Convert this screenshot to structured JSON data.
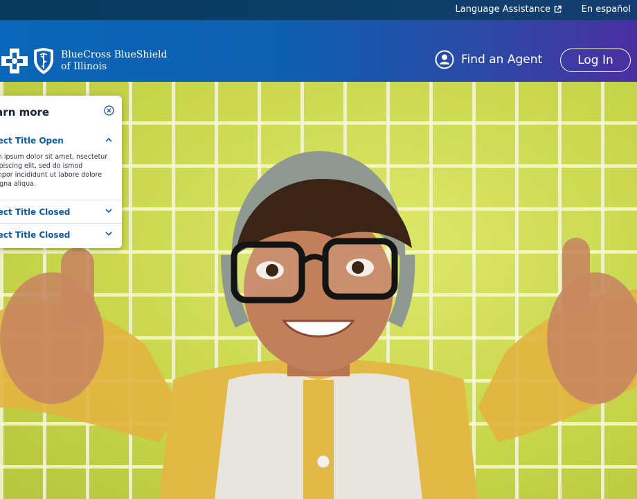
{
  "utility_bar": {
    "language_assistance": "Language Assistance",
    "espanol": "En español"
  },
  "header": {
    "brand_line1": "BlueCross BlueShield",
    "brand_line2": "of Illinois",
    "find_agent": "Find an Agent",
    "login": "Log In"
  },
  "panel": {
    "title": "earn more",
    "accordion": [
      {
        "title": "bject Title Open",
        "state": "open",
        "body": "rem ipsum dolor sit amet, nsectetur adipiscing elit, sed do ismod tempor incididunt ut labore dolore magna aliqua."
      },
      {
        "title": "bject Title Closed",
        "state": "closed"
      },
      {
        "title": "bject Title Closed",
        "state": "closed"
      }
    ]
  },
  "colors": {
    "utility_bar": "#0c3f68",
    "header_start": "#0a66b8",
    "header_end": "#4a2fa1",
    "accent_link": "#0a5ca8",
    "tile_wall": "#cbd94e"
  },
  "icons": [
    "external-link-icon",
    "bcbs-cross-icon",
    "bcbs-shield-icon",
    "user-icon",
    "close-circle-icon",
    "chevron-up-icon",
    "chevron-down-icon"
  ]
}
